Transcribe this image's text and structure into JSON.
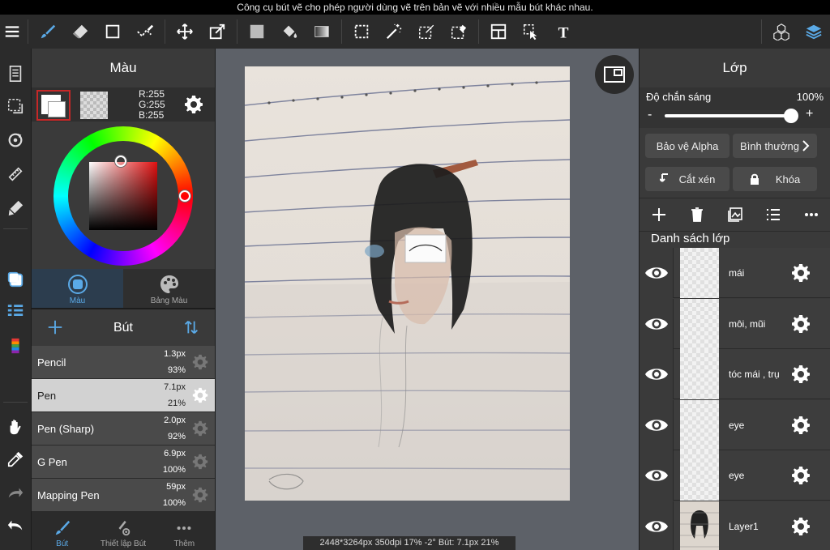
{
  "hint": "Công cụ bút vẽ cho phép người dùng vẽ trên bản vẽ với nhiều mẫu bút khác nhau.",
  "color_panel": {
    "title": "Màu",
    "r": "R:255",
    "g": "G:255",
    "b": "B:255",
    "tabs": [
      {
        "label": "Màu",
        "icon": "color-circle-icon"
      },
      {
        "label": "Bảng Màu",
        "icon": "palette-icon"
      }
    ]
  },
  "brush_panel": {
    "title": "Bút",
    "brushes": [
      {
        "name": "Pencil",
        "size": "1.3px",
        "opacity": "93%"
      },
      {
        "name": "Pen",
        "size": "7.1px",
        "opacity": "21%"
      },
      {
        "name": "Pen (Sharp)",
        "size": "2.0px",
        "opacity": "92%"
      },
      {
        "name": "G Pen",
        "size": "6.9px",
        "opacity": "100%"
      },
      {
        "name": "Mapping Pen",
        "size": "59px",
        "opacity": "100%"
      }
    ],
    "selected_index": 1,
    "tabs": [
      {
        "label": "Bút"
      },
      {
        "label": "Thiết lập Bút"
      },
      {
        "label": "Thêm"
      }
    ]
  },
  "canvas": {
    "status": "2448*3264px 350dpi 17% -2° Bút: 7.1px 21%"
  },
  "layers_panel": {
    "title": "Lớp",
    "opacity_label": "Độ chắn sáng",
    "opacity_value": "100%",
    "opacity_fraction": 1.0,
    "alpha_protect": "Bảo vệ Alpha",
    "blend_mode": "Bình thường",
    "clipping": "Cắt xén",
    "lock": "Khóa",
    "list_title": "Danh sách lớp",
    "layers": [
      {
        "name": "mái"
      },
      {
        "name": "môi, mũi"
      },
      {
        "name": "tóc mái , trụ"
      },
      {
        "name": "eye"
      },
      {
        "name": "eye"
      },
      {
        "name": "Layer1"
      }
    ]
  },
  "colors": {
    "accent": "#5aa9e6",
    "selected_swatch_border": "#c62828"
  }
}
